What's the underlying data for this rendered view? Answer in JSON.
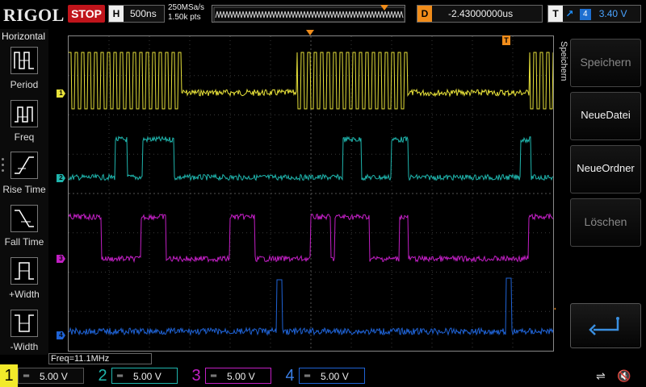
{
  "topbar": {
    "brand": "RIGOL",
    "run_state": "STOP",
    "timebase_tag": "H",
    "timebase_value": "500ns",
    "sample_rate": "250MSa/s",
    "memory_depth": "1.50k pts",
    "delay_tag": "D",
    "delay_value": "-2.43000000us",
    "trigger_tag": "T",
    "trigger_source": "4",
    "trigger_level": "3.40 V"
  },
  "left_panel": {
    "title": "Horizontal",
    "items": [
      {
        "label": "Period",
        "icon": "period-icon"
      },
      {
        "label": "Freq",
        "icon": "freq-icon"
      },
      {
        "label": "Rise Time",
        "icon": "rise-time-icon"
      },
      {
        "label": "Fall Time",
        "icon": "fall-time-icon"
      },
      {
        "label": "+Width",
        "icon": "positive-width-icon"
      },
      {
        "label": "-Width",
        "icon": "negative-width-icon"
      }
    ]
  },
  "right_menu": {
    "title": "Speichern",
    "buttons": [
      {
        "label": "Speichern",
        "enabled": false
      },
      {
        "label": "NeueDatei",
        "enabled": true
      },
      {
        "label": "NeueOrdner",
        "enabled": true
      },
      {
        "label": "Löschen",
        "enabled": false
      }
    ],
    "back_icon": "return-arrow-icon"
  },
  "measurement": {
    "freq": "Freq=11.1MHz"
  },
  "channels": [
    {
      "num": "1",
      "scale": "5.00 V",
      "color": "#e8e23a"
    },
    {
      "num": "2",
      "scale": "5.00 V",
      "color": "#1fb5ad"
    },
    {
      "num": "3",
      "scale": "5.00 V",
      "color": "#c21fc4"
    },
    {
      "num": "4",
      "scale": "5.00 V",
      "color": "#1f63d6"
    }
  ],
  "markers": {
    "trigger_position": "T",
    "ch1": "1",
    "ch2": "2",
    "ch3": "3",
    "ch4": "4"
  },
  "status_icons": [
    "usb-icon",
    "speaker-mute-icon"
  ],
  "colors": {
    "stop": "#c0141b",
    "accent_orange": "#f08c1a",
    "grid": "#444444"
  }
}
